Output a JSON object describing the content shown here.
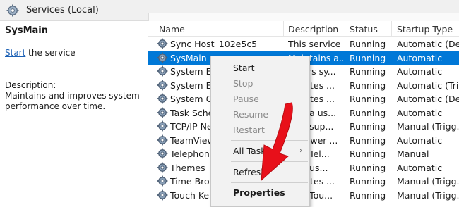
{
  "window": {
    "title": "Services (Local)"
  },
  "details": {
    "service_name": "SysMain",
    "action_link": "Start",
    "action_rest": " the service",
    "description_label": "Description:",
    "description": "Maintains and improves system performance over time."
  },
  "table": {
    "columns": [
      "Name",
      "Description",
      "Status",
      "Startup Type"
    ],
    "rows": [
      {
        "name": "Sync Host_102e5c5",
        "description": "This service ...",
        "status": "Running",
        "startup": "Automatic (De...",
        "selected": false
      },
      {
        "name": "SysMain",
        "description": "Maintains a...",
        "status": "Running",
        "startup": "Automatic",
        "selected": true
      },
      {
        "name": "System Ev",
        "description": "...itors sy...",
        "status": "Running",
        "startup": "Automatic",
        "selected": false
      },
      {
        "name": "System Ev",
        "description": "...inates ...",
        "status": "Running",
        "startup": "Automatic (Tri...",
        "selected": false
      },
      {
        "name": "System Gu",
        "description": "...inates ...",
        "status": "Running",
        "startup": "Automatic (De...",
        "selected": false
      },
      {
        "name": "Task Sche",
        "description": "...es a us...",
        "status": "Running",
        "startup": "Automatic",
        "selected": false
      },
      {
        "name": "TCP/IP Ne",
        "description": "...es sup...",
        "status": "Running",
        "startup": "Manual (Trigg...",
        "selected": false
      },
      {
        "name": "TeamView",
        "description": "...Viewer ...",
        "status": "Running",
        "startup": "Automatic",
        "selected": false
      },
      {
        "name": "Telephony",
        "description": "...es Tel...",
        "status": "Running",
        "startup": "Manual",
        "selected": false
      },
      {
        "name": "Themes",
        "description": "...es us...",
        "status": "Running",
        "startup": "Automatic",
        "selected": false
      },
      {
        "name": "Time Brok",
        "description": "...inates ...",
        "status": "Running",
        "startup": "Manual (Trigg...",
        "selected": false
      },
      {
        "name": "Touch Key",
        "description": "...es Tou...",
        "status": "Running",
        "startup": "Manual (Trigg...",
        "selected": false
      }
    ]
  },
  "context_menu": {
    "items": [
      "Start",
      "Stop",
      "Pause",
      "Resume",
      "Restart",
      "All Tasks",
      "Refresh",
      "Properties"
    ],
    "submenu_glyph": "›"
  },
  "colors": {
    "selection": "#0078d7",
    "arrow": "#e8101a",
    "link": "#1a5fb4"
  },
  "icons": {
    "service": "gear-icon",
    "window": "services-gear-icon"
  }
}
